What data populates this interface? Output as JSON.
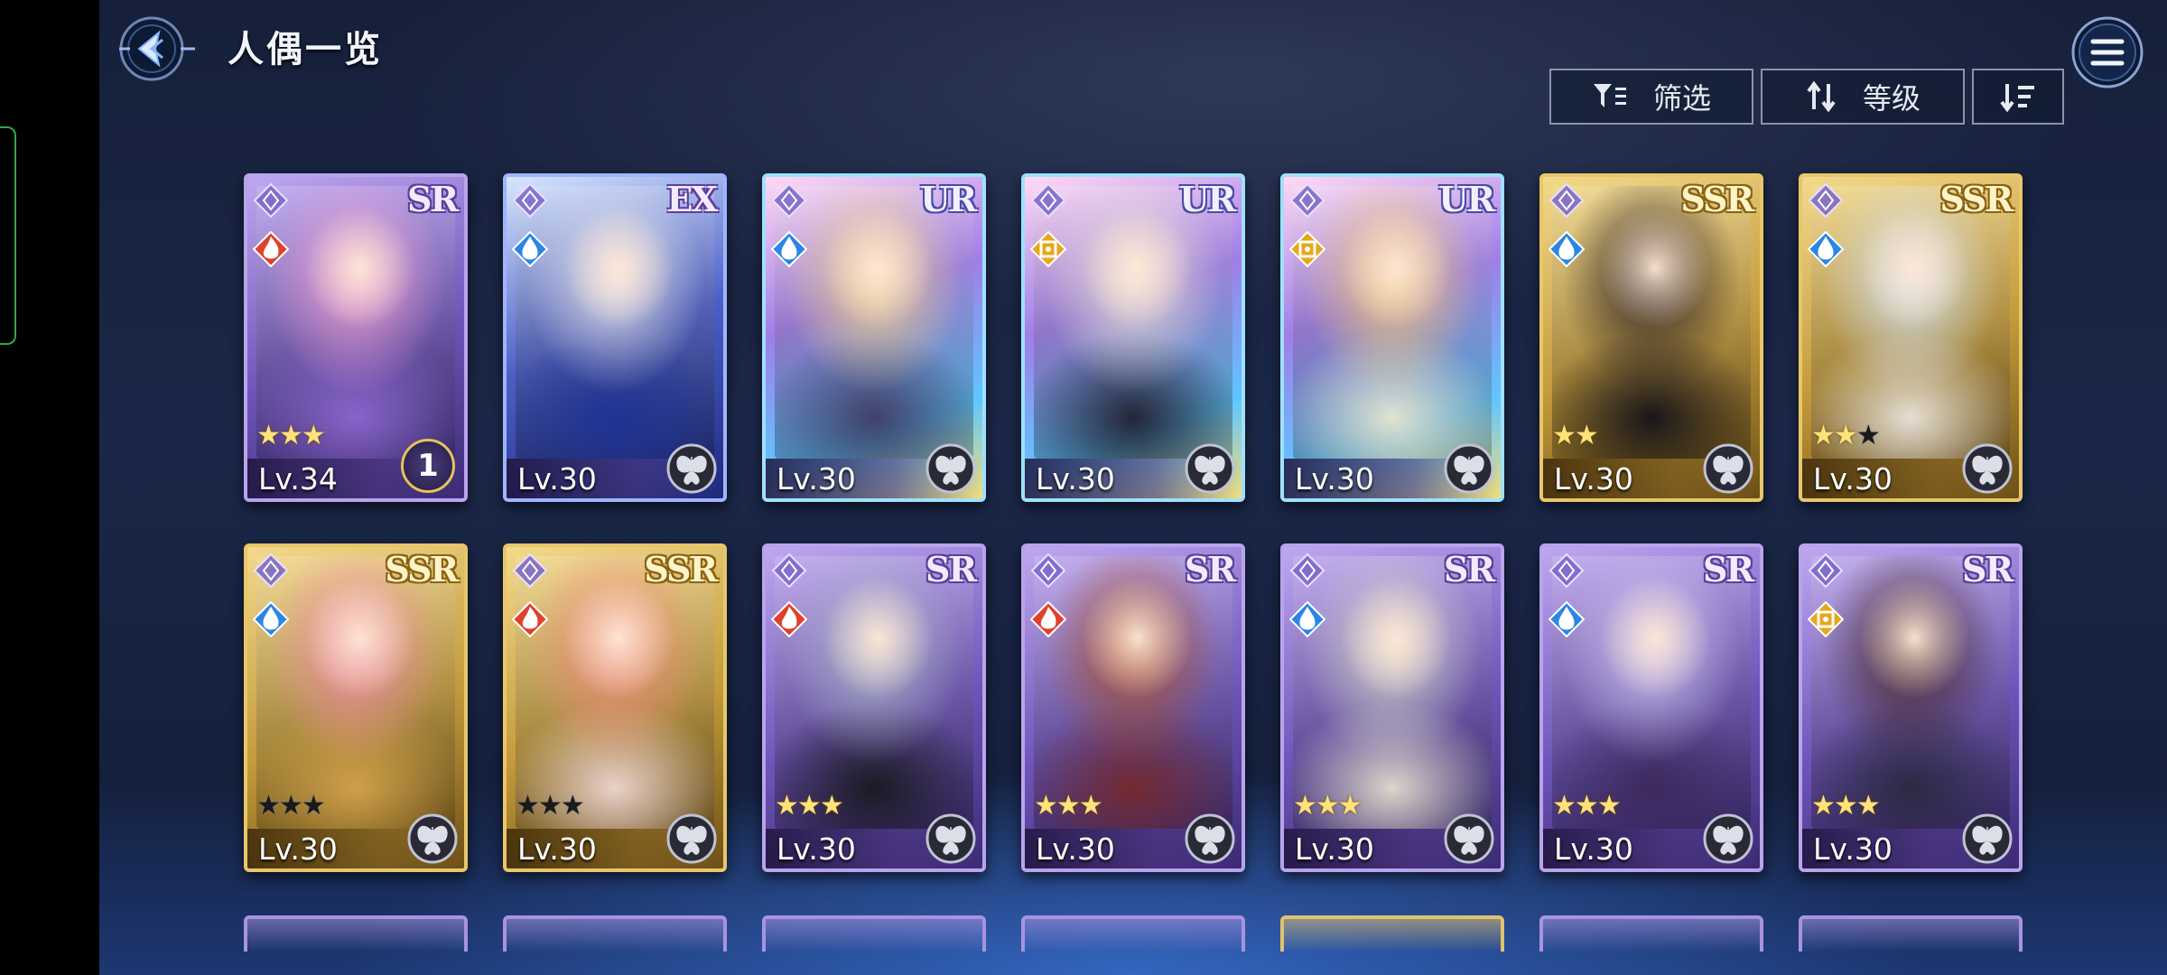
{
  "header": {
    "title": "人偶一览"
  },
  "toolbar": {
    "filter_label": "筛选",
    "sort_label": "等级"
  },
  "colors": {
    "accent": "#5fb8ff",
    "fire": "#e0402c",
    "water": "#2a86e6",
    "light": "#e6a81a"
  },
  "cards": [
    {
      "rarity": "SR",
      "level": "Lv.34",
      "element": "fire",
      "class": "mage",
      "stars": 3,
      "max_stars": 3,
      "badge": "1"
    },
    {
      "rarity": "EX",
      "level": "Lv.30",
      "element": "water",
      "class": "mage",
      "stars": 0,
      "max_stars": 0,
      "badge": ""
    },
    {
      "rarity": "UR",
      "level": "Lv.30",
      "element": "water",
      "class": "mage",
      "stars": 0,
      "max_stars": 0,
      "badge": ""
    },
    {
      "rarity": "UR",
      "level": "Lv.30",
      "element": "light",
      "class": "mage",
      "stars": 0,
      "max_stars": 0,
      "badge": ""
    },
    {
      "rarity": "UR",
      "level": "Lv.30",
      "element": "light",
      "class": "guardian",
      "stars": 0,
      "max_stars": 0,
      "badge": ""
    },
    {
      "rarity": "SSR",
      "level": "Lv.30",
      "element": "water",
      "class": "mage",
      "stars": 2,
      "max_stars": 2,
      "badge": ""
    },
    {
      "rarity": "SSR",
      "level": "Lv.30",
      "element": "water",
      "class": "support",
      "stars": 2,
      "max_stars": 3,
      "badge": ""
    },
    {
      "rarity": "SSR",
      "level": "Lv.30",
      "element": "water",
      "class": "archer",
      "stars": 0,
      "max_stars": 3,
      "badge": ""
    },
    {
      "rarity": "SSR",
      "level": "Lv.30",
      "element": "fire",
      "class": "mage",
      "stars": 0,
      "max_stars": 3,
      "badge": ""
    },
    {
      "rarity": "SR",
      "level": "Lv.30",
      "element": "fire",
      "class": "mage",
      "stars": 3,
      "max_stars": 3,
      "badge": ""
    },
    {
      "rarity": "SR",
      "level": "Lv.30",
      "element": "fire",
      "class": "warrior",
      "stars": 3,
      "max_stars": 3,
      "badge": ""
    },
    {
      "rarity": "SR",
      "level": "Lv.30",
      "element": "water",
      "class": "mage",
      "stars": 3,
      "max_stars": 3,
      "badge": ""
    },
    {
      "rarity": "SR",
      "level": "Lv.30",
      "element": "water",
      "class": "support",
      "stars": 3,
      "max_stars": 3,
      "badge": ""
    },
    {
      "rarity": "SR",
      "level": "Lv.30",
      "element": "light",
      "class": "guardian",
      "stars": 3,
      "max_stars": 3,
      "badge": ""
    }
  ]
}
